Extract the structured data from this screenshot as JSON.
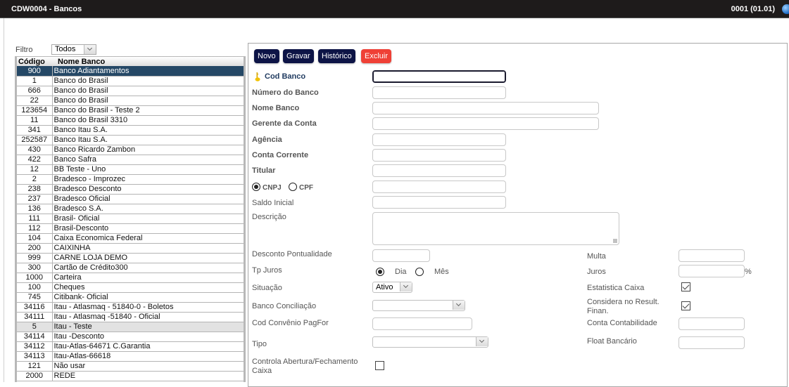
{
  "window": {
    "title": "CDW0004 - Bancos",
    "version": "0001 (01.01)",
    "globe_icon": "globe-icon"
  },
  "filter": {
    "label": "Filtro",
    "selected": "Todos"
  },
  "grid": {
    "columns": [
      "Código",
      "Nome Banco"
    ],
    "selected_index": 0,
    "hover_index": 30,
    "rows": [
      {
        "code": "900",
        "name": "Banco Adiantamentos"
      },
      {
        "code": "1",
        "name": "Banco do Brasil"
      },
      {
        "code": "666",
        "name": "Banco do Brasil"
      },
      {
        "code": "22",
        "name": "Banco do Brasil"
      },
      {
        "code": "123654",
        "name": "Banco do Brasil - Teste 2"
      },
      {
        "code": "11",
        "name": "Banco do Brasil 3310"
      },
      {
        "code": "341",
        "name": "Banco Itau S.A."
      },
      {
        "code": "252587",
        "name": "Banco Itau S.A."
      },
      {
        "code": "430",
        "name": "Banco Ricardo Zambon"
      },
      {
        "code": "422",
        "name": "Banco Safra"
      },
      {
        "code": "12",
        "name": "BB Teste - Uno"
      },
      {
        "code": "2",
        "name": "Bradesco - Improzec"
      },
      {
        "code": "238",
        "name": "Bradesco Desconto"
      },
      {
        "code": "237",
        "name": "Bradesco Oficial"
      },
      {
        "code": "136",
        "name": "Bradesco S.A."
      },
      {
        "code": "111",
        "name": "Brasil- Oficial"
      },
      {
        "code": "112",
        "name": "Brasil-Desconto"
      },
      {
        "code": "104",
        "name": "Caixa Economica Federal"
      },
      {
        "code": "200",
        "name": "CAIXINHA"
      },
      {
        "code": "999",
        "name": "CARNE LOJA DEMO"
      },
      {
        "code": "300",
        "name": "Cartão de Crédito300"
      },
      {
        "code": "1000",
        "name": "Carteira"
      },
      {
        "code": "100",
        "name": "Cheques"
      },
      {
        "code": "745",
        "name": "Citibank- Oficial"
      },
      {
        "code": "34116",
        "name": "Itau - Atlasmaq - 51840-0 - Boletos"
      },
      {
        "code": "34111",
        "name": "Itau - Atlasmaq -51840 - Oficial"
      },
      {
        "code": "5",
        "name": "Itau - Teste"
      },
      {
        "code": "34114",
        "name": "Itau -Desconto"
      },
      {
        "code": "34112",
        "name": "Itau-Atlas-64671 C.Garantia"
      },
      {
        "code": "34113",
        "name": "Itau-Atlas-66618"
      },
      {
        "code": "121",
        "name": "Não usar"
      },
      {
        "code": "2000",
        "name": "REDE"
      }
    ]
  },
  "toolbar": {
    "novo": "Novo",
    "gravar": "Gravar",
    "historico": "Histórico",
    "excluir": "Excluir"
  },
  "colors": {
    "primary_button": "#0d1446",
    "danger_button": "#ef4036",
    "selected_row": "#254866",
    "titlebar": "#1e1b1b"
  },
  "form": {
    "cod_banco": {
      "label": "Cod Banco",
      "value": ""
    },
    "numero_banco": {
      "label": "Número do Banco",
      "value": ""
    },
    "nome_banco": {
      "label": "Nome Banco",
      "value": ""
    },
    "gerente_conta": {
      "label": "Gerente da Conta",
      "value": ""
    },
    "agencia": {
      "label": "Agência",
      "value": ""
    },
    "conta_corrente": {
      "label": "Conta Corrente",
      "value": ""
    },
    "titular": {
      "label": "Titular",
      "value": ""
    },
    "doc_type": {
      "options": [
        "CNPJ",
        "CPF"
      ],
      "selected": "CNPJ",
      "value": ""
    },
    "saldo_inicial": {
      "label": "Saldo Inicial",
      "value": ""
    },
    "descricao": {
      "label": "Descrição",
      "value": ""
    },
    "desconto_pontualidade": {
      "label": "Desconto Pontualidade",
      "value": ""
    },
    "tp_juros": {
      "label": "Tp Juros",
      "options": [
        "Dia",
        "Mês"
      ],
      "selected": "Dia"
    },
    "situacao": {
      "label": "Situação",
      "selected": "Ativo"
    },
    "banco_conciliacao": {
      "label": "Banco Conciliação",
      "selected": ""
    },
    "cod_convenio": {
      "label": "Cod Convênio PagFor",
      "value": ""
    },
    "tipo": {
      "label": "Tipo",
      "selected": ""
    },
    "controla_caixa": {
      "label_line1": "Controla Abertura/Fechamento",
      "label_line2": "Caixa",
      "checked": false
    },
    "multa": {
      "label": "Multa",
      "value": ""
    },
    "juros": {
      "label": "Juros",
      "value": "",
      "suffix": "%"
    },
    "estatistica_caixa": {
      "label": "Estatistica Caixa",
      "checked": true
    },
    "considera_resultado": {
      "label_line1": "Considera no Result.",
      "label_line2": "Finan.",
      "checked": true
    },
    "conta_contabilidade": {
      "label": "Conta Contabilidade",
      "value": ""
    },
    "float_bancario": {
      "label": "Float Bancário",
      "value": ""
    }
  }
}
